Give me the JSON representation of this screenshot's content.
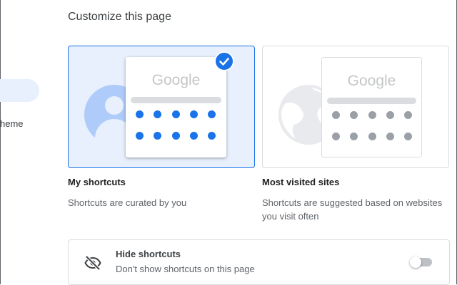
{
  "sidebar": {
    "theme_label_partial": "heme"
  },
  "page_title": "Customize this page",
  "options": [
    {
      "title": "My shortcuts",
      "description": "Shortcuts are curated by you",
      "logo_text": "Google",
      "selected": true
    },
    {
      "title": "Most visited sites",
      "description_line1": "Shortcuts are suggested based on websites",
      "description_line2": "you visit often",
      "logo_text": "Google",
      "selected": false
    }
  ],
  "hide_shortcuts": {
    "title": "Hide shortcuts",
    "description": "Don't show shortcuts on this page",
    "toggle_on": false
  },
  "colors": {
    "accent": "#1a73e8",
    "selected_bg": "#e8f0fe",
    "border": "#dadce0"
  }
}
